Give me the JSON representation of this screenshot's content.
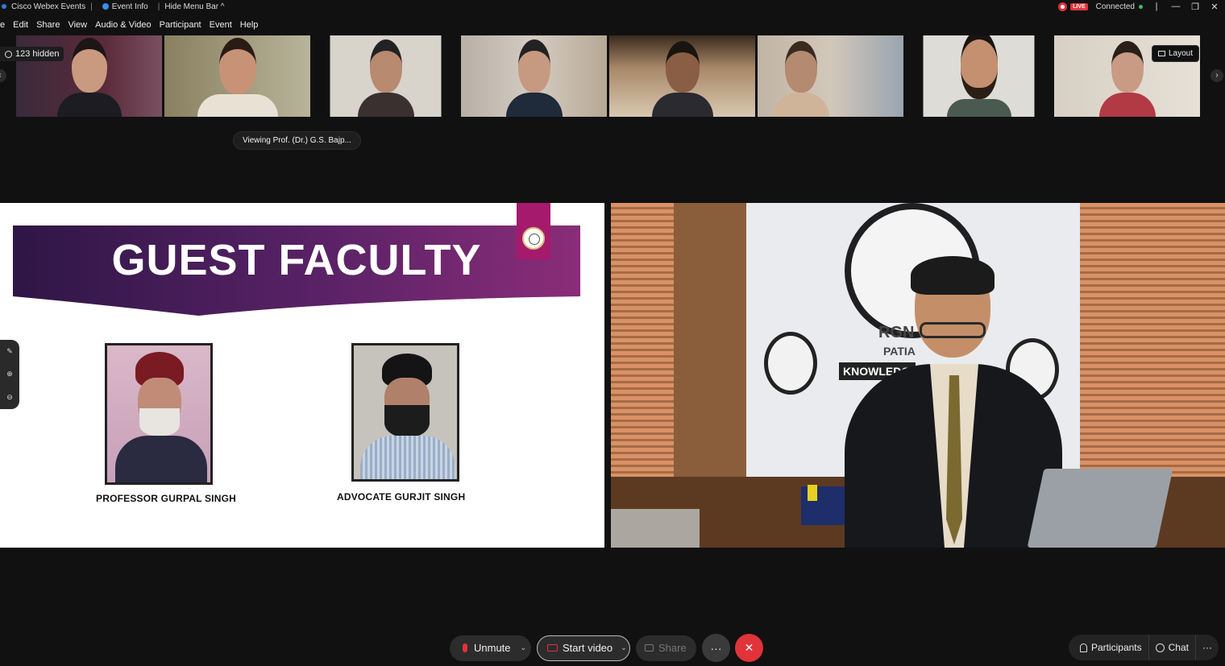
{
  "titlebar": {
    "app_name": "Cisco Webex Events",
    "event_info": "Event Info",
    "hide_menu": "Hide Menu Bar ^",
    "live": "LIVE",
    "status": "Connected"
  },
  "menu": {
    "items": [
      "e",
      "Edit",
      "Share",
      "View",
      "Audio & Video",
      "Participant",
      "Event",
      "Help"
    ]
  },
  "strip": {
    "hidden_count": "123 hidden",
    "layout_label": "Layout"
  },
  "viewing": "Viewing Prof. (Dr.) G.S. Bajp...",
  "slide": {
    "title": "GUEST FACULTY",
    "faculty": [
      {
        "name": "PROFESSOR GURPAL SINGH"
      },
      {
        "name": "ADVOCATE GURJIT SINGH"
      }
    ]
  },
  "video": {
    "emblem_text": "RGN",
    "emblem_sub": "PATIA",
    "banner_text": "KNOWLEDGE"
  },
  "controls": {
    "unmute": "Unmute",
    "start_video": "Start video",
    "share": "Share",
    "more": "···",
    "participants": "Participants",
    "chat": "Chat",
    "overflow": "···"
  },
  "colors": {
    "end_button": "#e0333a",
    "banner_purple": "#5a2266",
    "seal_tab": "#a61a6d"
  }
}
